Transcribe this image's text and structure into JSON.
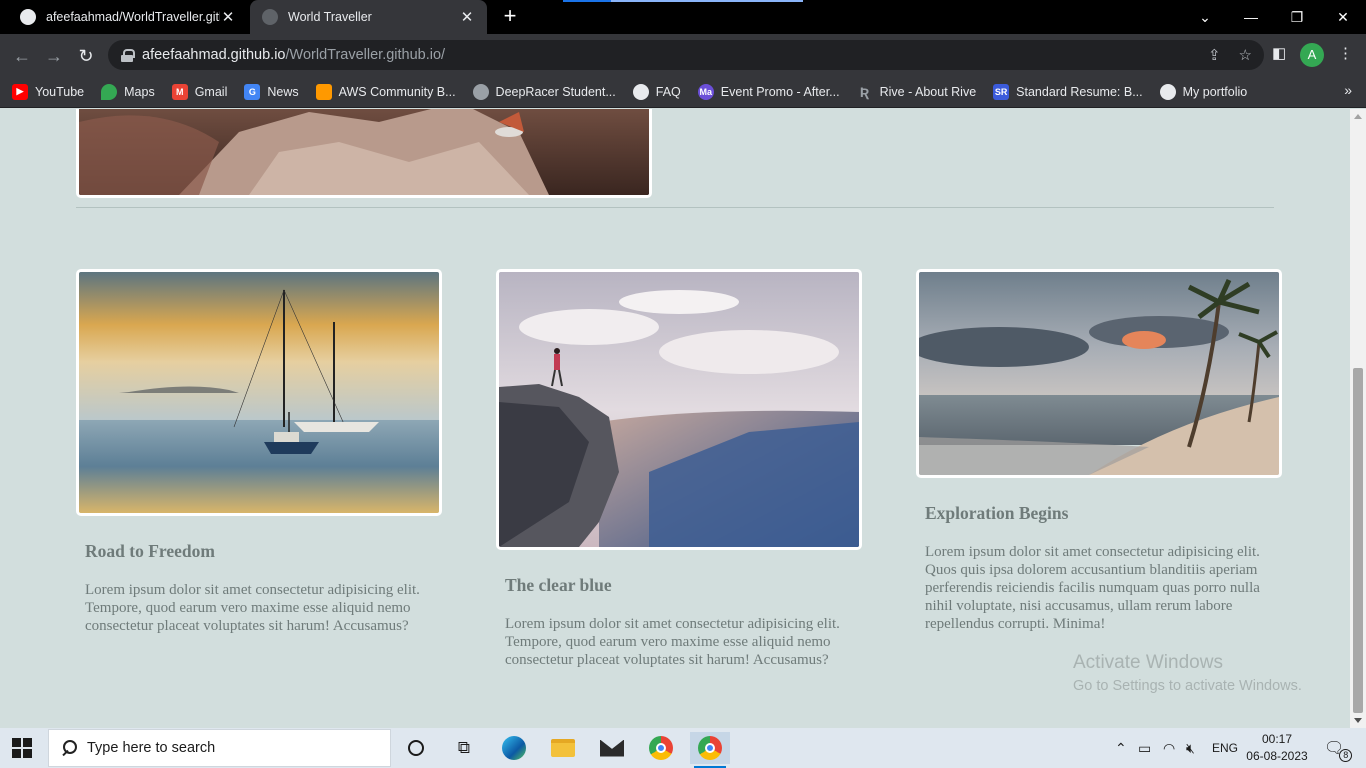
{
  "browser": {
    "tabs": [
      {
        "title": "afeefaahmad/WorldTraveller.github.io",
        "active": false
      },
      {
        "title": "World Traveller",
        "active": true
      }
    ],
    "url_host": "afeefaahmad.github.io",
    "url_path": "/WorldTraveller.github.io/",
    "profile_initial": "A",
    "bookmarks": [
      {
        "label": "YouTube",
        "icon": "youtube-icon",
        "color": "#ff0000"
      },
      {
        "label": "Maps",
        "icon": "maps-icon",
        "color": "#34a853"
      },
      {
        "label": "Gmail",
        "icon": "gmail-icon",
        "color": "#ea4335"
      },
      {
        "label": "News",
        "icon": "news-icon",
        "color": "#4285f4"
      },
      {
        "label": "AWS Community B...",
        "icon": "aws-icon",
        "color": "#ff9900"
      },
      {
        "label": "DeepRacer Student...",
        "icon": "deepracer-icon",
        "color": "#9aa0a6"
      },
      {
        "label": "FAQ",
        "icon": "globe-icon",
        "color": "#e8eaed"
      },
      {
        "label": "Event Promo - After...",
        "icon": "ma-icon",
        "color": "#6b4fd8"
      },
      {
        "label": "Rive - About Rive",
        "icon": "rive-icon",
        "color": "#9aa0a6"
      },
      {
        "label": "Standard Resume: B...",
        "icon": "sr-icon",
        "color": "#3b5bdb"
      },
      {
        "label": "My portfolio",
        "icon": "globe-icon",
        "color": "#e8eaed"
      }
    ]
  },
  "cards": [
    {
      "title": "Road to Freedom",
      "text": "Lorem ipsum dolor sit amet consectetur adipisicing elit. Tempore, quod earum vero maxime esse aliquid nemo consectetur placeat voluptates sit harum! Accusamus?"
    },
    {
      "title": "The clear blue",
      "text": "Lorem ipsum dolor sit amet consectetur adipisicing elit. Tempore, quod earum vero maxime esse aliquid nemo consectetur placeat voluptates sit harum! Accusamus?"
    },
    {
      "title": "Exploration Begins",
      "text": "Lorem ipsum dolor sit amet consectetur adipisicing elit. Quos quis ipsa dolorem accusantium blanditiis aperiam perferendis reiciendis facilis numquam quas porro nulla nihil voluptate, nisi accusamus, ullam rerum labore repellendus corrupti. Minima!"
    }
  ],
  "watermark": {
    "line1": "Activate Windows",
    "line2": "Go to Settings to activate Windows."
  },
  "taskbar": {
    "search_placeholder": "Type here to search",
    "language": "ENG",
    "time": "00:17",
    "date": "06-08-2023",
    "notification_count": "8"
  }
}
